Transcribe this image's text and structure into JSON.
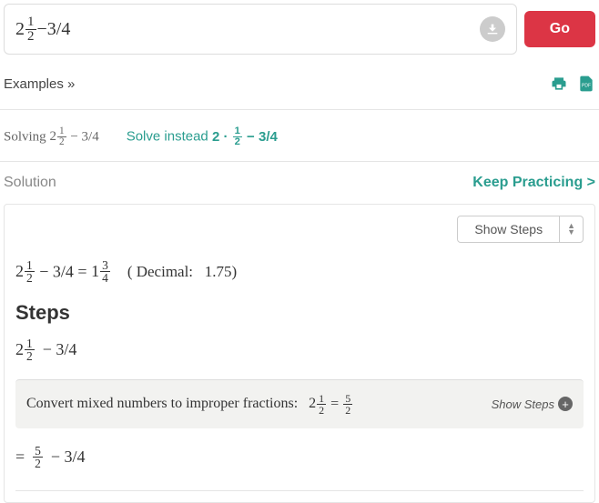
{
  "input": {
    "expression_whole": "2",
    "expression_frac_num": "1",
    "expression_frac_den": "2",
    "expression_rest": "−3/4"
  },
  "go_button": "Go",
  "examples_link": "Examples »",
  "solving": {
    "prefix": "Solving ",
    "expr_whole": "2",
    "expr_num": "1",
    "expr_den": "2",
    "expr_rest": " − 3/4",
    "instead_prefix": "Solve instead ",
    "instead_bold_a": "2 · ",
    "instead_bold_num": "1",
    "instead_bold_den": "2",
    "instead_bold_b": " − 3/4"
  },
  "solution_label": "Solution",
  "keep_practicing": "Keep Practicing >",
  "show_steps_select": "Show Steps",
  "result": {
    "lhs_whole": "2",
    "lhs_num": "1",
    "lhs_den": "2",
    "lhs_rest": " − 3/4 = ",
    "rhs_whole": "1",
    "rhs_num": "3",
    "rhs_den": "4",
    "decimal_open": "( Decimal:",
    "decimal_val": "1.75",
    "decimal_close": ")"
  },
  "steps_heading": "Steps",
  "step1": {
    "whole": "2",
    "num": "1",
    "den": "2",
    "rest": " − 3/4"
  },
  "hint": {
    "text": "Convert mixed numbers to improper fractions:",
    "expr_whole": "2",
    "expr_num": "1",
    "expr_den": "2",
    "eq": " = ",
    "res_num": "5",
    "res_den": "2",
    "show": "Show Steps"
  },
  "step2": {
    "prefix": "= ",
    "num": "5",
    "den": "2",
    "rest": " − 3/4"
  }
}
